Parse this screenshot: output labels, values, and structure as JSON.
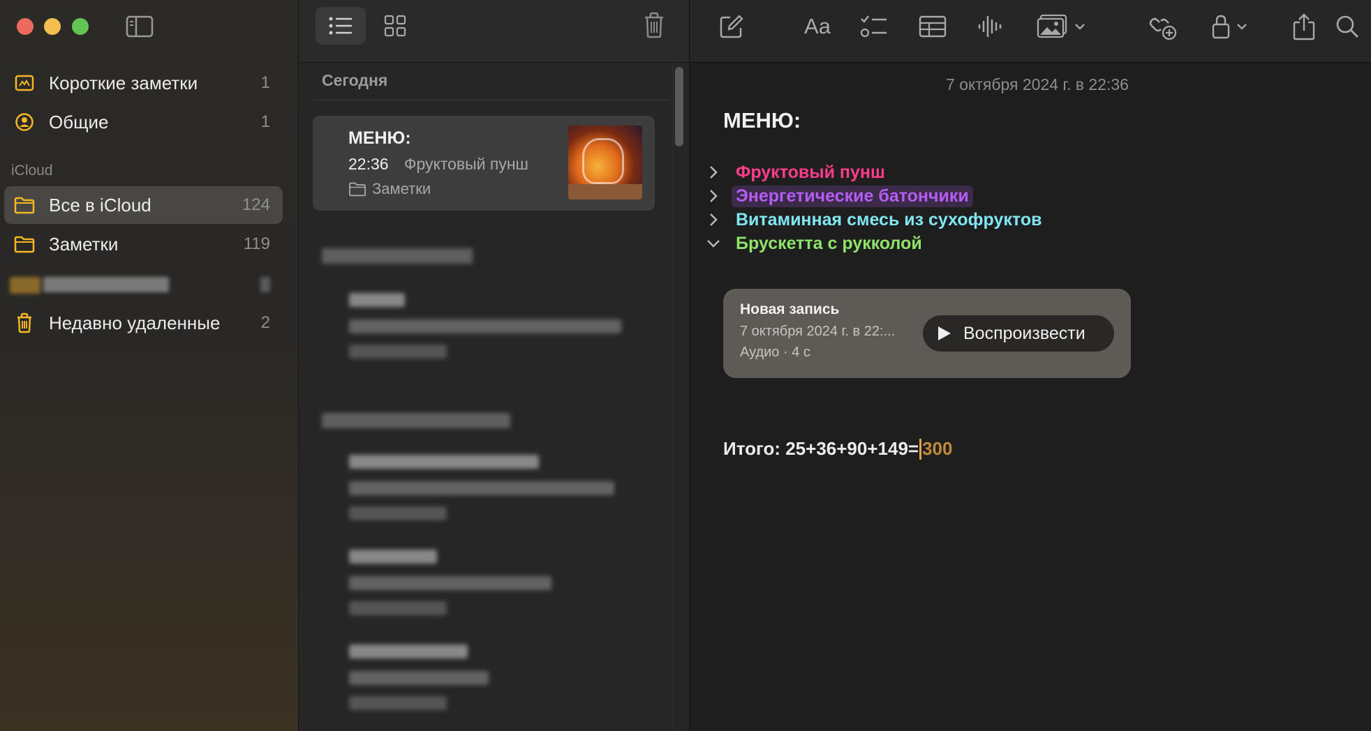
{
  "window": {
    "controls": [
      "close",
      "minimize",
      "zoom"
    ]
  },
  "sidebar": {
    "pinned": [
      {
        "label": "Короткие заметки",
        "count": "1",
        "icon": "quick-notes-icon"
      },
      {
        "label": "Общие",
        "count": "1",
        "icon": "shared-person-icon"
      }
    ],
    "section_title": "iCloud",
    "icloud_items": [
      {
        "label": "Все в iCloud",
        "count": "124",
        "icon": "folder-icon",
        "selected": true
      },
      {
        "label": "Заметки",
        "count": "119",
        "icon": "folder-icon"
      },
      {
        "label": "Недавно удаленные",
        "count": "2",
        "icon": "trash-icon"
      }
    ]
  },
  "note_list": {
    "group_title": "Сегодня",
    "selected_note": {
      "title": "МЕНЮ:",
      "time": "22:36",
      "snippet": "Фруктовый пунш",
      "folder": "Заметки"
    }
  },
  "editor": {
    "date": "7 октября 2024 г. в 22:36",
    "heading": "МЕНЮ:",
    "items": [
      {
        "text": "Фруктовый пунш",
        "color": "#ff3d8b",
        "expanded": false
      },
      {
        "text": "Энергетические батончики",
        "color": "#b45cf5",
        "expanded": false,
        "highlight": "#3b2a48"
      },
      {
        "text": "Витаминная смесь из сухофруктов",
        "color": "#7fe6f2",
        "expanded": false
      },
      {
        "text": "Брускетта с рукколой",
        "color": "#8fe36a",
        "expanded": true
      }
    ],
    "audio": {
      "title": "Новая запись",
      "date": "7 октября 2024 г. в 22:...",
      "meta": "Аудио · 4 с",
      "play_label": "Воспроизвести"
    },
    "total": {
      "expression": "Итого: 25+36+90+149=",
      "result": "300"
    }
  },
  "colors": {
    "accent_folder": "#f5b824",
    "background": "#1e1e1e"
  }
}
